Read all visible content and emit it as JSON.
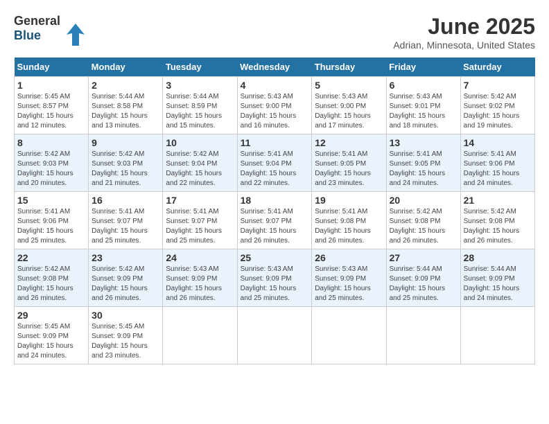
{
  "logo": {
    "general": "General",
    "blue": "Blue"
  },
  "title": "June 2025",
  "subtitle": "Adrian, Minnesota, United States",
  "days_of_week": [
    "Sunday",
    "Monday",
    "Tuesday",
    "Wednesday",
    "Thursday",
    "Friday",
    "Saturday"
  ],
  "weeks": [
    [
      {
        "day": "1",
        "sunrise": "Sunrise: 5:45 AM",
        "sunset": "Sunset: 8:57 PM",
        "daylight": "Daylight: 15 hours and 12 minutes."
      },
      {
        "day": "2",
        "sunrise": "Sunrise: 5:44 AM",
        "sunset": "Sunset: 8:58 PM",
        "daylight": "Daylight: 15 hours and 13 minutes."
      },
      {
        "day": "3",
        "sunrise": "Sunrise: 5:44 AM",
        "sunset": "Sunset: 8:59 PM",
        "daylight": "Daylight: 15 hours and 15 minutes."
      },
      {
        "day": "4",
        "sunrise": "Sunrise: 5:43 AM",
        "sunset": "Sunset: 9:00 PM",
        "daylight": "Daylight: 15 hours and 16 minutes."
      },
      {
        "day": "5",
        "sunrise": "Sunrise: 5:43 AM",
        "sunset": "Sunset: 9:00 PM",
        "daylight": "Daylight: 15 hours and 17 minutes."
      },
      {
        "day": "6",
        "sunrise": "Sunrise: 5:43 AM",
        "sunset": "Sunset: 9:01 PM",
        "daylight": "Daylight: 15 hours and 18 minutes."
      },
      {
        "day": "7",
        "sunrise": "Sunrise: 5:42 AM",
        "sunset": "Sunset: 9:02 PM",
        "daylight": "Daylight: 15 hours and 19 minutes."
      }
    ],
    [
      {
        "day": "8",
        "sunrise": "Sunrise: 5:42 AM",
        "sunset": "Sunset: 9:03 PM",
        "daylight": "Daylight: 15 hours and 20 minutes."
      },
      {
        "day": "9",
        "sunrise": "Sunrise: 5:42 AM",
        "sunset": "Sunset: 9:03 PM",
        "daylight": "Daylight: 15 hours and 21 minutes."
      },
      {
        "day": "10",
        "sunrise": "Sunrise: 5:42 AM",
        "sunset": "Sunset: 9:04 PM",
        "daylight": "Daylight: 15 hours and 22 minutes."
      },
      {
        "day": "11",
        "sunrise": "Sunrise: 5:41 AM",
        "sunset": "Sunset: 9:04 PM",
        "daylight": "Daylight: 15 hours and 22 minutes."
      },
      {
        "day": "12",
        "sunrise": "Sunrise: 5:41 AM",
        "sunset": "Sunset: 9:05 PM",
        "daylight": "Daylight: 15 hours and 23 minutes."
      },
      {
        "day": "13",
        "sunrise": "Sunrise: 5:41 AM",
        "sunset": "Sunset: 9:05 PM",
        "daylight": "Daylight: 15 hours and 24 minutes."
      },
      {
        "day": "14",
        "sunrise": "Sunrise: 5:41 AM",
        "sunset": "Sunset: 9:06 PM",
        "daylight": "Daylight: 15 hours and 24 minutes."
      }
    ],
    [
      {
        "day": "15",
        "sunrise": "Sunrise: 5:41 AM",
        "sunset": "Sunset: 9:06 PM",
        "daylight": "Daylight: 15 hours and 25 minutes."
      },
      {
        "day": "16",
        "sunrise": "Sunrise: 5:41 AM",
        "sunset": "Sunset: 9:07 PM",
        "daylight": "Daylight: 15 hours and 25 minutes."
      },
      {
        "day": "17",
        "sunrise": "Sunrise: 5:41 AM",
        "sunset": "Sunset: 9:07 PM",
        "daylight": "Daylight: 15 hours and 25 minutes."
      },
      {
        "day": "18",
        "sunrise": "Sunrise: 5:41 AM",
        "sunset": "Sunset: 9:07 PM",
        "daylight": "Daylight: 15 hours and 26 minutes."
      },
      {
        "day": "19",
        "sunrise": "Sunrise: 5:41 AM",
        "sunset": "Sunset: 9:08 PM",
        "daylight": "Daylight: 15 hours and 26 minutes."
      },
      {
        "day": "20",
        "sunrise": "Sunrise: 5:42 AM",
        "sunset": "Sunset: 9:08 PM",
        "daylight": "Daylight: 15 hours and 26 minutes."
      },
      {
        "day": "21",
        "sunrise": "Sunrise: 5:42 AM",
        "sunset": "Sunset: 9:08 PM",
        "daylight": "Daylight: 15 hours and 26 minutes."
      }
    ],
    [
      {
        "day": "22",
        "sunrise": "Sunrise: 5:42 AM",
        "sunset": "Sunset: 9:08 PM",
        "daylight": "Daylight: 15 hours and 26 minutes."
      },
      {
        "day": "23",
        "sunrise": "Sunrise: 5:42 AM",
        "sunset": "Sunset: 9:09 PM",
        "daylight": "Daylight: 15 hours and 26 minutes."
      },
      {
        "day": "24",
        "sunrise": "Sunrise: 5:43 AM",
        "sunset": "Sunset: 9:09 PM",
        "daylight": "Daylight: 15 hours and 26 minutes."
      },
      {
        "day": "25",
        "sunrise": "Sunrise: 5:43 AM",
        "sunset": "Sunset: 9:09 PM",
        "daylight": "Daylight: 15 hours and 25 minutes."
      },
      {
        "day": "26",
        "sunrise": "Sunrise: 5:43 AM",
        "sunset": "Sunset: 9:09 PM",
        "daylight": "Daylight: 15 hours and 25 minutes."
      },
      {
        "day": "27",
        "sunrise": "Sunrise: 5:44 AM",
        "sunset": "Sunset: 9:09 PM",
        "daylight": "Daylight: 15 hours and 25 minutes."
      },
      {
        "day": "28",
        "sunrise": "Sunrise: 5:44 AM",
        "sunset": "Sunset: 9:09 PM",
        "daylight": "Daylight: 15 hours and 24 minutes."
      }
    ],
    [
      {
        "day": "29",
        "sunrise": "Sunrise: 5:45 AM",
        "sunset": "Sunset: 9:09 PM",
        "daylight": "Daylight: 15 hours and 24 minutes."
      },
      {
        "day": "30",
        "sunrise": "Sunrise: 5:45 AM",
        "sunset": "Sunset: 9:09 PM",
        "daylight": "Daylight: 15 hours and 23 minutes."
      },
      null,
      null,
      null,
      null,
      null
    ]
  ]
}
